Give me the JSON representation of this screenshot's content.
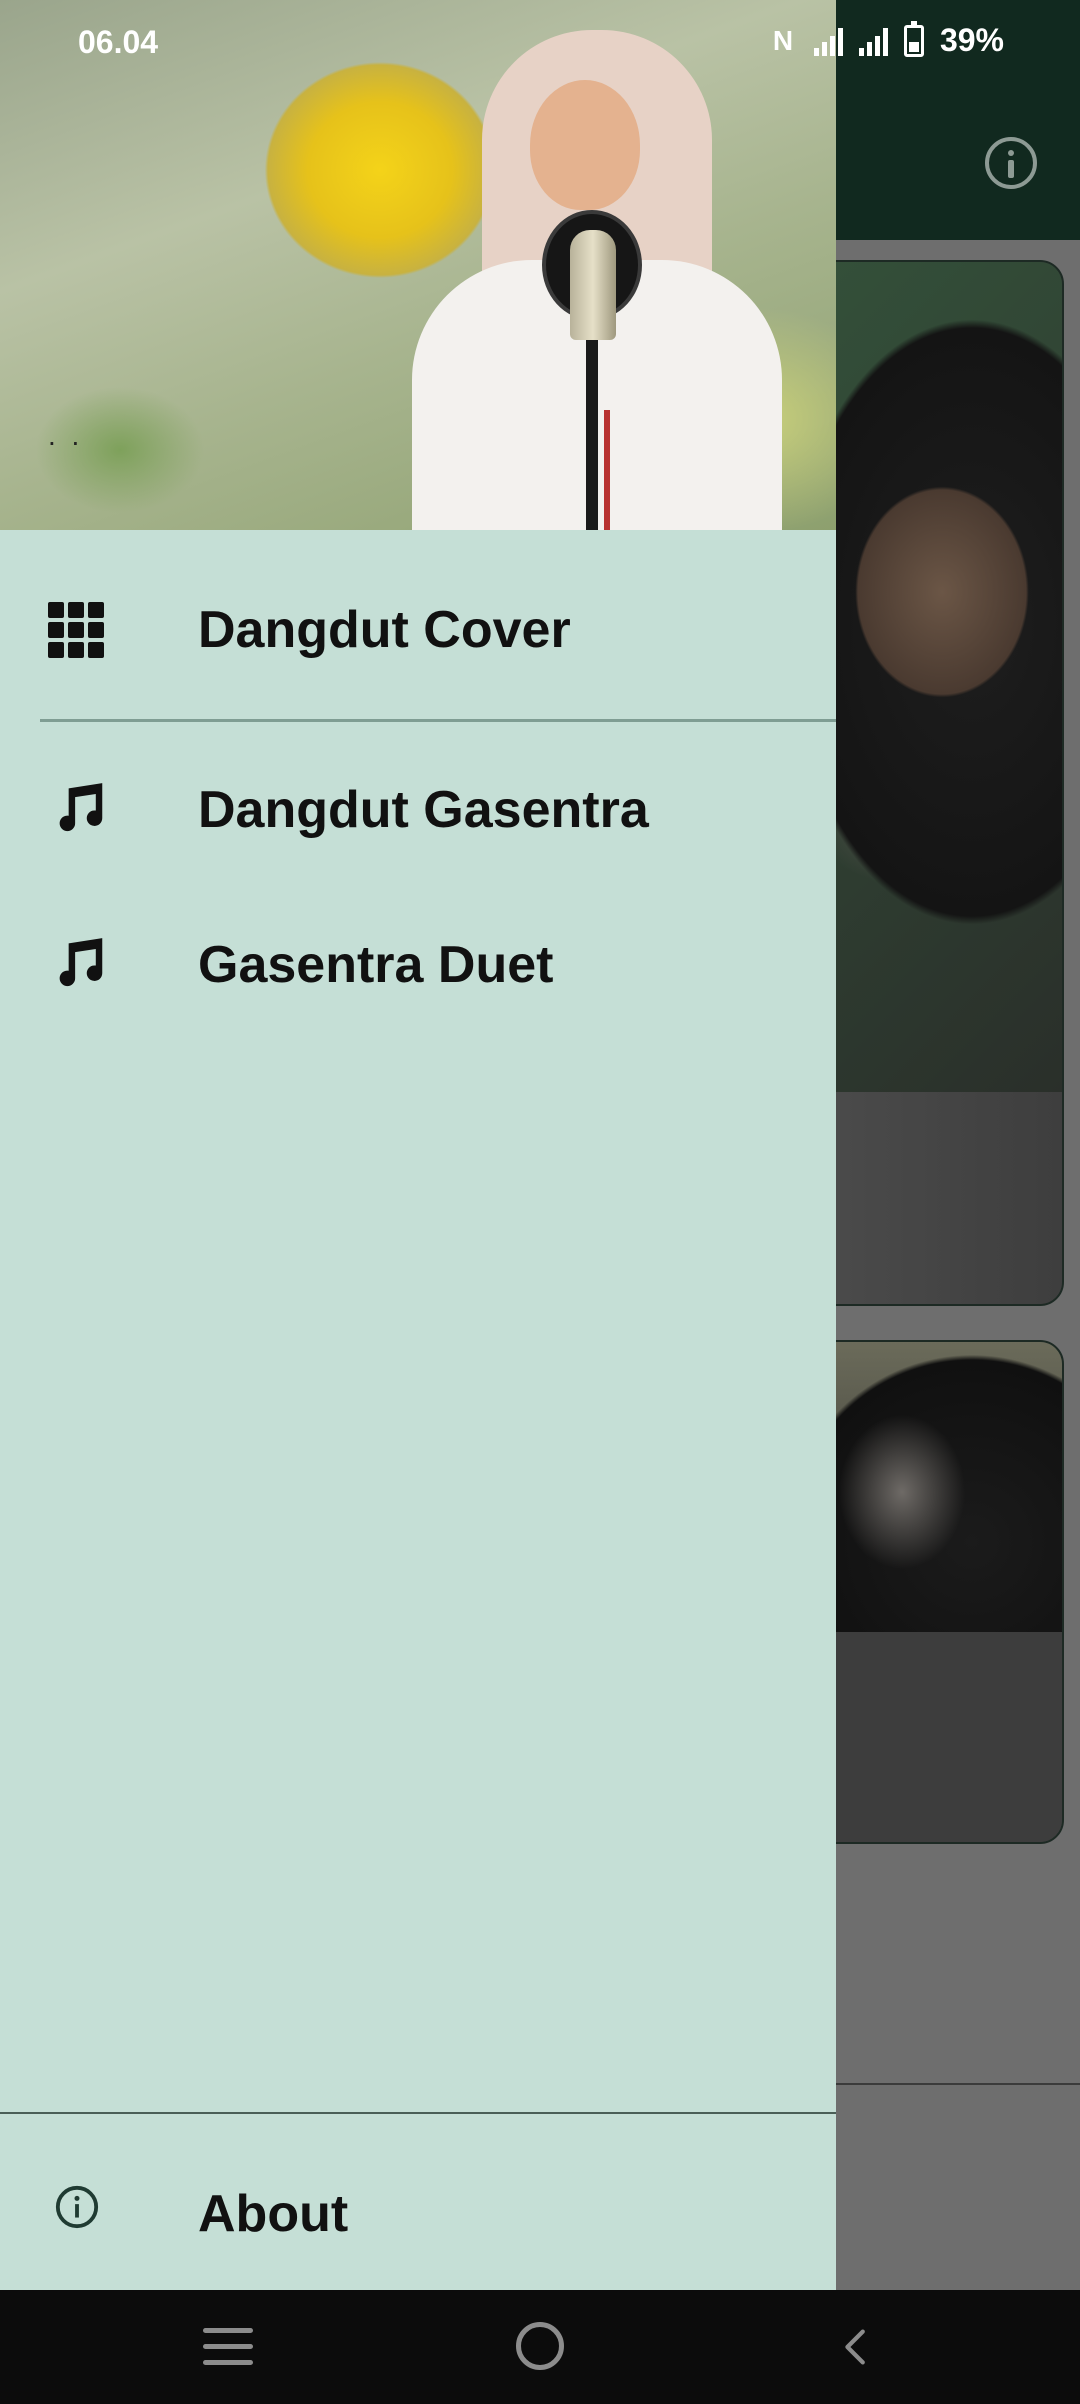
{
  "status_bar": {
    "time": "06.04",
    "battery": "39%",
    "icons": [
      "nfc-icon",
      "signal-icon",
      "signal-icon",
      "battery-icon"
    ]
  },
  "app_bar": {
    "actions": [
      "info-icon"
    ]
  },
  "drawer": {
    "header": {
      "caption": ". ."
    },
    "menu": [
      {
        "label": "Dangdut Cover",
        "icon": "grid-icon"
      },
      {
        "label": "Dangdut Gasentra",
        "icon": "music-note-icon"
      },
      {
        "label": "Gasentra Duet",
        "icon": "music-note-icon"
      }
    ],
    "footer": {
      "label": "About",
      "icon": "info-icon"
    }
  },
  "nav_bar": {
    "buttons": [
      "recent-apps-icon",
      "home-icon",
      "back-icon"
    ]
  },
  "colors": {
    "drawer_bg": "#c5dfd6",
    "app_bar_bg": "#11291f",
    "scrim": "#6e6e6e",
    "nav_bar_bg": "#0c0c0c"
  }
}
